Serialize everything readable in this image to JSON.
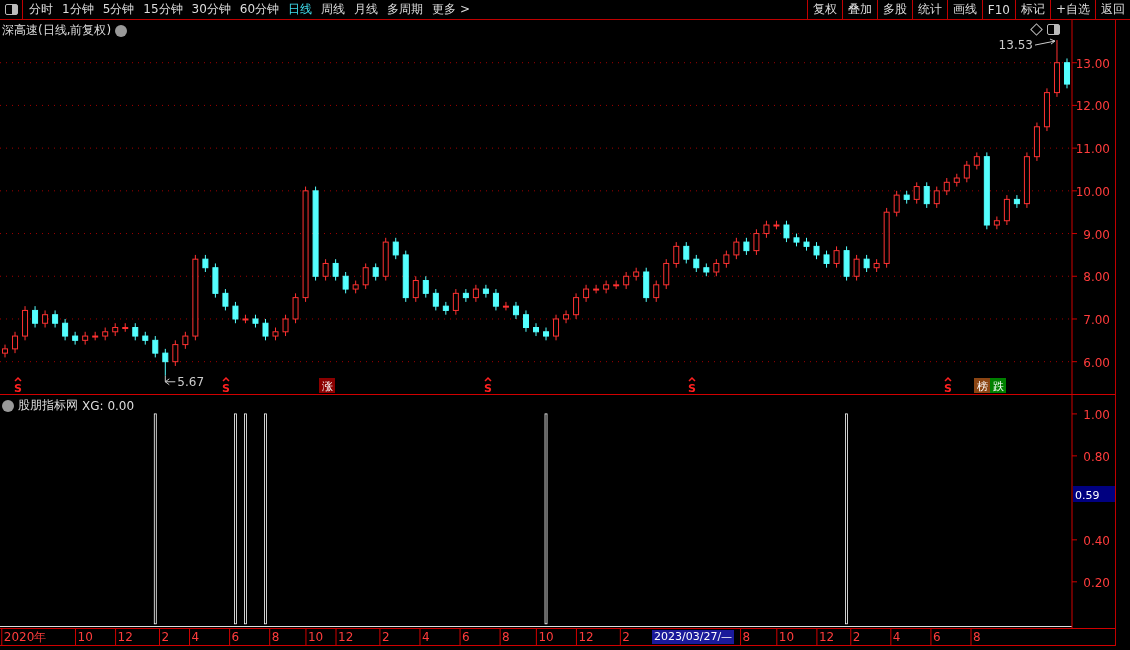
{
  "toolbar": {
    "periods": [
      {
        "label": "分时",
        "selected": false
      },
      {
        "label": "1分钟",
        "selected": false
      },
      {
        "label": "5分钟",
        "selected": false
      },
      {
        "label": "15分钟",
        "selected": false
      },
      {
        "label": "30分钟",
        "selected": false
      },
      {
        "label": "60分钟",
        "selected": false
      },
      {
        "label": "日线",
        "selected": true
      },
      {
        "label": "周线",
        "selected": false
      },
      {
        "label": "月线",
        "selected": false
      },
      {
        "label": "多周期",
        "selected": false
      },
      {
        "label": "更多 >",
        "selected": false
      }
    ],
    "buttons": [
      "复权",
      "叠加",
      "多股",
      "统计",
      "画线",
      "F10",
      "标记",
      "+自选",
      "返回"
    ]
  },
  "price_pane": {
    "title": "深高速(日线,前复权)",
    "cursor_date": "2023/03/27/—",
    "chart_data": {
      "type": "candlestick",
      "grid": true,
      "ylim": [
        5.22,
        14.0
      ],
      "yticks": [
        {
          "value": 6,
          "label": "6.00"
        },
        {
          "value": 7,
          "label": "7.00"
        },
        {
          "value": 8,
          "label": "8.00"
        },
        {
          "value": 9,
          "label": "9.00"
        },
        {
          "value": 10,
          "label": "10.00"
        },
        {
          "value": 11,
          "label": "11.00"
        },
        {
          "value": 12,
          "label": "12.00"
        },
        {
          "value": 13,
          "label": "13.00"
        }
      ],
      "categories": [
        null,
        null,
        null,
        null,
        null,
        null,
        null,
        null,
        null,
        null,
        null,
        null,
        null,
        null,
        null,
        null,
        null,
        null,
        null,
        null,
        null,
        null,
        null,
        null,
        null,
        null,
        null,
        null,
        null,
        null,
        null,
        null,
        null,
        null,
        null,
        null,
        null,
        null,
        null,
        null,
        null,
        null,
        null,
        null,
        null,
        null,
        null,
        null,
        null,
        null,
        null,
        null,
        null,
        null,
        null,
        null,
        null,
        null,
        null,
        null,
        null,
        null,
        null,
        null,
        null,
        null,
        null,
        null,
        null,
        null,
        null,
        null,
        null,
        null,
        null,
        null,
        null,
        null,
        null,
        null,
        null,
        null,
        null,
        null,
        null,
        null,
        null,
        null,
        null,
        null,
        null,
        null,
        null,
        null,
        null,
        null,
        null,
        null,
        null,
        null,
        null,
        null,
        null,
        null,
        null,
        null,
        null
      ],
      "ohlc": [
        [
          6.2,
          6.4,
          6.1,
          6.3
        ],
        [
          6.3,
          6.7,
          6.2,
          6.6
        ],
        [
          6.6,
          7.3,
          6.5,
          7.2
        ],
        [
          7.2,
          7.3,
          6.8,
          6.9
        ],
        [
          6.9,
          7.2,
          6.8,
          7.1
        ],
        [
          7.1,
          7.2,
          6.8,
          6.9
        ],
        [
          6.9,
          7.0,
          6.5,
          6.6
        ],
        [
          6.6,
          6.7,
          6.4,
          6.5
        ],
        [
          6.5,
          6.7,
          6.4,
          6.6
        ],
        [
          6.6,
          6.7,
          6.5,
          6.6
        ],
        [
          6.6,
          6.8,
          6.5,
          6.7
        ],
        [
          6.7,
          6.9,
          6.6,
          6.8
        ],
        [
          6.8,
          6.9,
          6.7,
          6.8
        ],
        [
          6.8,
          6.9,
          6.5,
          6.6
        ],
        [
          6.6,
          6.7,
          6.4,
          6.5
        ],
        [
          6.5,
          6.6,
          6.1,
          6.2
        ],
        [
          6.2,
          6.3,
          5.67,
          6.0
        ],
        [
          6.0,
          6.5,
          5.9,
          6.4
        ],
        [
          6.4,
          6.7,
          6.3,
          6.6
        ],
        [
          6.6,
          8.5,
          6.5,
          8.4
        ],
        [
          8.4,
          8.5,
          8.1,
          8.2
        ],
        [
          8.2,
          8.3,
          7.5,
          7.6
        ],
        [
          7.6,
          7.7,
          7.2,
          7.3
        ],
        [
          7.3,
          7.4,
          6.9,
          7.0
        ],
        [
          7.0,
          7.1,
          6.9,
          7.0
        ],
        [
          7.0,
          7.1,
          6.8,
          6.9
        ],
        [
          6.9,
          7.0,
          6.5,
          6.6
        ],
        [
          6.6,
          6.8,
          6.5,
          6.7
        ],
        [
          6.7,
          7.1,
          6.6,
          7.0
        ],
        [
          7.0,
          7.6,
          6.9,
          7.5
        ],
        [
          7.5,
          10.1,
          7.4,
          10.0
        ],
        [
          10.0,
          10.1,
          7.9,
          8.0
        ],
        [
          8.0,
          8.4,
          7.9,
          8.3
        ],
        [
          8.3,
          8.4,
          7.9,
          8.0
        ],
        [
          8.0,
          8.1,
          7.6,
          7.7
        ],
        [
          7.7,
          7.9,
          7.6,
          7.8
        ],
        [
          7.8,
          8.3,
          7.7,
          8.2
        ],
        [
          8.2,
          8.3,
          7.9,
          8.0
        ],
        [
          8.0,
          8.9,
          7.9,
          8.8
        ],
        [
          8.8,
          8.9,
          8.4,
          8.5
        ],
        [
          8.5,
          8.6,
          7.4,
          7.5
        ],
        [
          7.5,
          8.0,
          7.4,
          7.9
        ],
        [
          7.9,
          8.0,
          7.5,
          7.6
        ],
        [
          7.6,
          7.7,
          7.2,
          7.3
        ],
        [
          7.3,
          7.4,
          7.1,
          7.2
        ],
        [
          7.2,
          7.7,
          7.1,
          7.6
        ],
        [
          7.6,
          7.7,
          7.4,
          7.5
        ],
        [
          7.5,
          7.8,
          7.4,
          7.7
        ],
        [
          7.7,
          7.8,
          7.5,
          7.6
        ],
        [
          7.6,
          7.7,
          7.2,
          7.3
        ],
        [
          7.3,
          7.4,
          7.2,
          7.3
        ],
        [
          7.3,
          7.4,
          7.0,
          7.1
        ],
        [
          7.1,
          7.2,
          6.7,
          6.8
        ],
        [
          6.8,
          6.9,
          6.6,
          6.7
        ],
        [
          6.7,
          6.8,
          6.5,
          6.6
        ],
        [
          6.6,
          7.1,
          6.5,
          7.0
        ],
        [
          7.0,
          7.2,
          6.9,
          7.1
        ],
        [
          7.1,
          7.6,
          7.0,
          7.5
        ],
        [
          7.5,
          7.8,
          7.4,
          7.7
        ],
        [
          7.7,
          7.8,
          7.6,
          7.7
        ],
        [
          7.7,
          7.9,
          7.6,
          7.8
        ],
        [
          7.8,
          7.9,
          7.7,
          7.8
        ],
        [
          7.8,
          8.1,
          7.7,
          8.0
        ],
        [
          8.0,
          8.2,
          7.9,
          8.1
        ],
        [
          8.1,
          8.2,
          7.4,
          7.5
        ],
        [
          7.5,
          7.9,
          7.4,
          7.8
        ],
        [
          7.8,
          8.4,
          7.7,
          8.3
        ],
        [
          8.3,
          8.8,
          8.2,
          8.7
        ],
        [
          8.7,
          8.8,
          8.3,
          8.4
        ],
        [
          8.4,
          8.5,
          8.1,
          8.2
        ],
        [
          8.2,
          8.3,
          8.0,
          8.1
        ],
        [
          8.1,
          8.4,
          8.0,
          8.3
        ],
        [
          8.3,
          8.6,
          8.2,
          8.5
        ],
        [
          8.5,
          8.9,
          8.4,
          8.8
        ],
        [
          8.8,
          8.9,
          8.5,
          8.6
        ],
        [
          8.6,
          9.1,
          8.5,
          9.0
        ],
        [
          9.0,
          9.3,
          8.9,
          9.2
        ],
        [
          9.2,
          9.3,
          9.1,
          9.2
        ],
        [
          9.2,
          9.3,
          8.8,
          8.9
        ],
        [
          8.9,
          9.0,
          8.7,
          8.8
        ],
        [
          8.8,
          8.9,
          8.6,
          8.7
        ],
        [
          8.7,
          8.8,
          8.4,
          8.5
        ],
        [
          8.5,
          8.6,
          8.2,
          8.3
        ],
        [
          8.3,
          8.7,
          8.2,
          8.6
        ],
        [
          8.6,
          8.7,
          7.9,
          8.0
        ],
        [
          8.0,
          8.5,
          7.9,
          8.4
        ],
        [
          8.4,
          8.5,
          8.1,
          8.2
        ],
        [
          8.2,
          8.4,
          8.1,
          8.3
        ],
        [
          8.3,
          9.6,
          8.2,
          9.5
        ],
        [
          9.5,
          10.0,
          9.4,
          9.9
        ],
        [
          9.9,
          10.0,
          9.7,
          9.8
        ],
        [
          9.8,
          10.2,
          9.7,
          10.1
        ],
        [
          10.1,
          10.2,
          9.6,
          9.7
        ],
        [
          9.7,
          10.1,
          9.6,
          10.0
        ],
        [
          10.0,
          10.3,
          9.9,
          10.2
        ],
        [
          10.2,
          10.4,
          10.1,
          10.3
        ],
        [
          10.3,
          10.7,
          10.2,
          10.6
        ],
        [
          10.6,
          10.9,
          10.5,
          10.8
        ],
        [
          10.8,
          10.9,
          9.1,
          9.2
        ],
        [
          9.2,
          9.4,
          9.1,
          9.3
        ],
        [
          9.3,
          9.9,
          9.2,
          9.8
        ],
        [
          9.8,
          9.9,
          9.6,
          9.7
        ],
        [
          9.7,
          10.9,
          9.6,
          10.8
        ],
        [
          10.8,
          11.6,
          10.7,
          11.5
        ],
        [
          11.5,
          12.4,
          11.4,
          12.3
        ],
        [
          12.3,
          13.53,
          12.2,
          13.0
        ],
        [
          13.0,
          13.1,
          12.4,
          12.5
        ]
      ],
      "annotations": [
        "13.53",
        "5.67"
      ]
    },
    "markers": [
      {
        "kind": "signal",
        "text": "S"
      },
      {
        "kind": "signal",
        "text": "S"
      },
      {
        "kind": "tag",
        "text": "涨",
        "color": "#8b0000"
      },
      {
        "kind": "signal",
        "text": "S"
      },
      {
        "kind": "signal",
        "text": "S"
      },
      {
        "kind": "signal",
        "text": "S"
      },
      {
        "kind": "tag",
        "text": "榜",
        "color": "#8b4513"
      },
      {
        "kind": "tag",
        "text": "跌",
        "color": "#008000"
      }
    ]
  },
  "indicator_pane": {
    "title": "股朋指标网",
    "reading": ": 0.00",
    "cursor_value": "0.59",
    "chart_data": {
      "type": "bar",
      "ylim": [
        -0.02,
        1.09
      ],
      "yticks": [
        {
          "value": 0.2,
          "label": "0.20"
        },
        {
          "value": 0.4,
          "label": "0.40"
        },
        {
          "value": 0.8,
          "label": "0.80"
        },
        {
          "value": 1.0,
          "label": "1.00"
        }
      ],
      "categories": [
        null,
        null,
        "2020年",
        null,
        null,
        null,
        null,
        null,
        "10",
        null,
        null,
        null,
        "12",
        null,
        null,
        null,
        "2",
        null,
        null,
        "4",
        null,
        null,
        null,
        "6",
        null,
        null,
        null,
        "8",
        null,
        null,
        null,
        "10",
        null,
        null,
        "12",
        null,
        null,
        null,
        "2",
        null,
        null,
        null,
        "4",
        null,
        null,
        null,
        "6",
        null,
        null,
        null,
        "8",
        null,
        null,
        null,
        "10",
        null,
        null,
        null,
        "12",
        null,
        null,
        null,
        "2",
        null,
        null,
        null,
        null,
        null,
        null,
        null,
        null,
        null,
        null,
        null,
        "8",
        null,
        null,
        null,
        "10",
        null,
        null,
        null,
        "12",
        null,
        null,
        "2",
        null,
        null,
        null,
        "4",
        null,
        null,
        null,
        "6",
        null,
        null,
        null,
        "8",
        null,
        null,
        null,
        null,
        null,
        null,
        null,
        null,
        null
      ],
      "series": [
        {
          "name": "XG",
          "color": "#ffffff",
          "values": [
            0,
            0,
            0,
            0,
            0,
            0,
            0,
            0,
            0,
            0,
            0,
            0,
            0,
            0,
            0,
            1,
            0,
            0,
            0,
            0,
            0,
            0,
            0,
            1,
            1,
            0,
            1,
            0,
            0,
            0,
            0,
            0,
            0,
            0,
            0,
            0,
            0,
            0,
            0,
            0,
            0,
            0,
            0,
            0,
            0,
            0,
            0,
            0,
            0,
            0,
            0,
            0,
            0,
            0,
            1,
            0,
            0,
            0,
            0,
            0,
            0,
            0,
            0,
            0,
            0,
            0,
            0,
            0,
            0,
            0,
            0,
            0,
            0,
            0,
            0,
            0,
            0,
            0,
            0,
            0,
            0,
            0,
            0,
            0,
            1,
            0,
            0,
            0,
            0,
            0,
            0,
            0,
            0,
            0,
            0,
            0,
            0,
            0,
            0,
            0,
            0,
            0,
            0,
            0,
            0,
            0,
            0
          ]
        }
      ]
    }
  }
}
